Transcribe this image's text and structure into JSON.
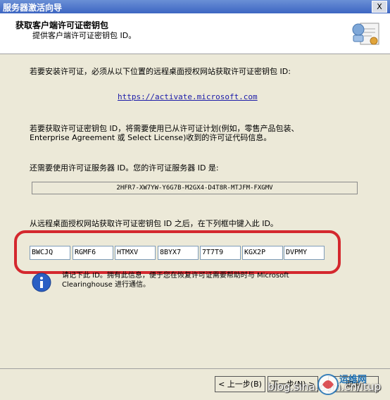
{
  "window": {
    "title": "服务器激活向导",
    "close_label": "X"
  },
  "header": {
    "title": "获取客户端许可证密钥包",
    "subtitle": "提供客户端许可证密钥包 ID。"
  },
  "main": {
    "intro": "若要安装许可证，必须从以下位置的远程桌面授权网站获取许可证密钥包 ID:",
    "url": "https://activate.microsoft.com",
    "plan_line1": "若要获取许可证密钥包 ID，将需要使用已从许可证计划(例如，零售产品包装、",
    "plan_line2": "Enterprise Agreement 或 Select License)收到的许可证代码信息。",
    "server_id_label": "还需要使用许可证服务器 ID。您的许可证服务器 ID 是:",
    "server_id": "2HFR7-XW7YW-Y6G7B-M2GX4-D4T8R-MTJFM-FXGMV",
    "enter_label": "从远程桌面授权网站获取许可证密钥包 ID 之后，在下列框中键入此 ID。",
    "key_fields": [
      "BWCJQ",
      "RGMF6",
      "HTMXV",
      "8BYX7",
      "7T7T9",
      "KGX2P",
      "DVPMY"
    ],
    "info_line1": "请记下此 ID。拥有此信息，便于您在恢复许可证需要帮助时与 Microsoft",
    "info_line2": "Clearinghouse 进行通信。"
  },
  "footer": {
    "back_label": "< 上一步(B)",
    "next_label": "下一步(N) >",
    "cancel_label": "取消"
  },
  "watermark": {
    "blog": "blog.sina.com.cn/itup",
    "logo": "运维网"
  },
  "colors": {
    "highlight_frame": "#d4282e",
    "title_bar": "#3d66c2",
    "dialog_bg": "#ece9d8"
  }
}
